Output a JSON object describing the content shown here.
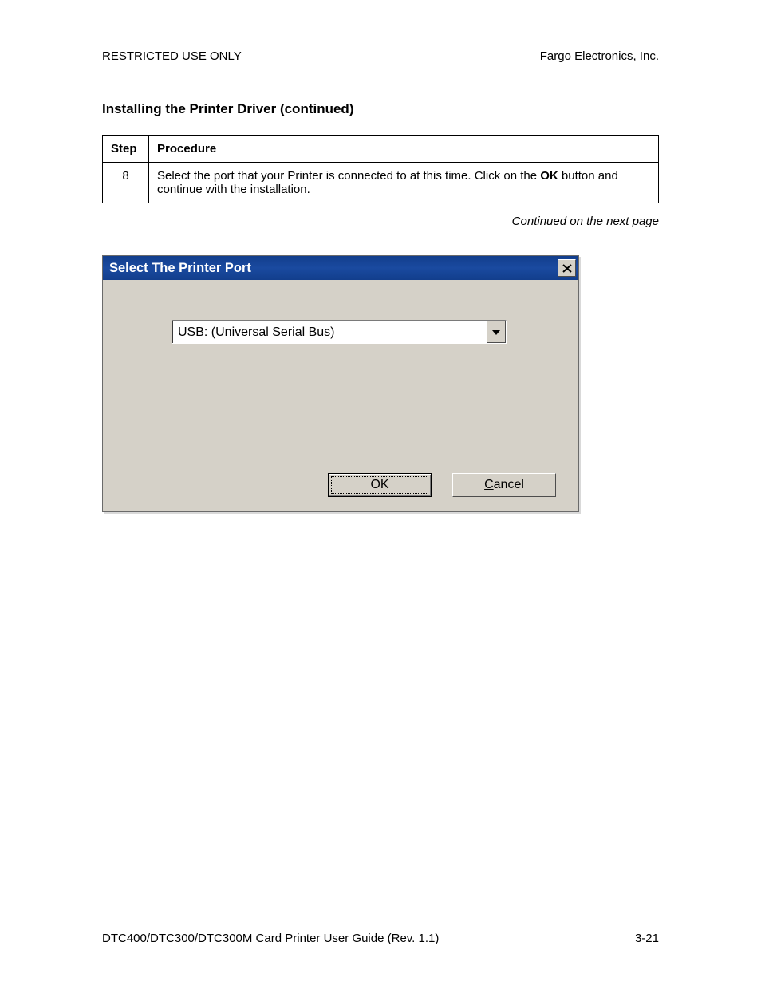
{
  "header": {
    "left": "RESTRICTED USE ONLY",
    "right": "Fargo Electronics, Inc."
  },
  "section_title": "Installing the Printer Driver (continued)",
  "table": {
    "headers": {
      "step": "Step",
      "procedure": "Procedure"
    },
    "row": {
      "step": "8",
      "proc_part1": "Select the port that your Printer is connected to at this time. Click on the ",
      "proc_bold": "OK",
      "proc_part2": " button and continue with the installation."
    }
  },
  "continued_text": "Continued on the next page",
  "dialog": {
    "title": "Select The Printer Port",
    "combo_value": "USB: (Universal Serial Bus)",
    "ok_label": "OK",
    "cancel_prefix": "C",
    "cancel_rest": "ancel"
  },
  "footer": {
    "left": "DTC400/DTC300/DTC300M Card Printer User Guide (Rev. 1.1)",
    "right": "3-21"
  }
}
